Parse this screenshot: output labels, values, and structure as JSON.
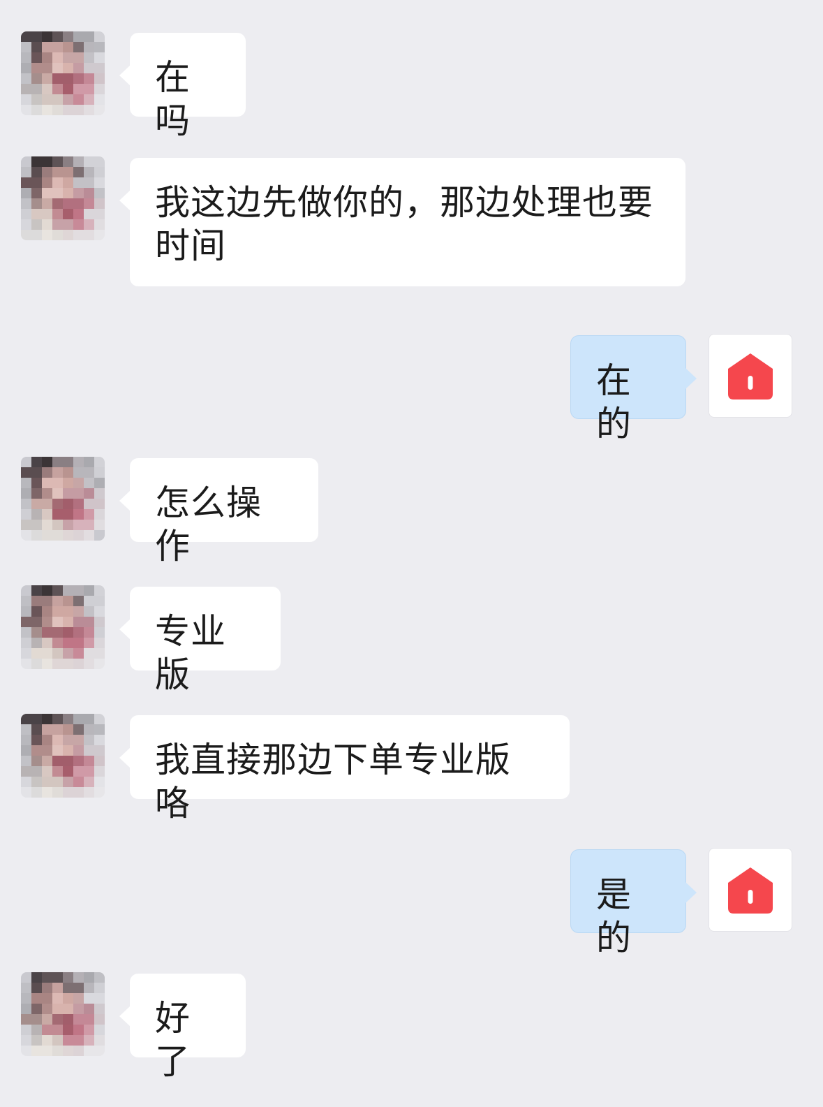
{
  "conversation": {
    "messages": [
      {
        "side": "left",
        "text": "在吗"
      },
      {
        "side": "left",
        "text": "我这边先做你的，那边处理也要时间"
      },
      {
        "side": "right",
        "text": "在的"
      },
      {
        "side": "left",
        "text": "怎么操作"
      },
      {
        "side": "left",
        "text": "专业版"
      },
      {
        "side": "left",
        "text": "我直接那边下单专业版咯"
      },
      {
        "side": "right",
        "text": "是的"
      },
      {
        "side": "left",
        "text": "好了"
      }
    ]
  },
  "avatars": {
    "contact": {
      "icon": "pixelated-photo-avatar"
    },
    "self": {
      "icon": "red-house-icon",
      "color": "#f5474d"
    }
  },
  "colors": {
    "background": "#ededf1",
    "incoming_bubble": "#ffffff",
    "outgoing_bubble": "#cde5fb",
    "text": "#1b1b1b"
  }
}
